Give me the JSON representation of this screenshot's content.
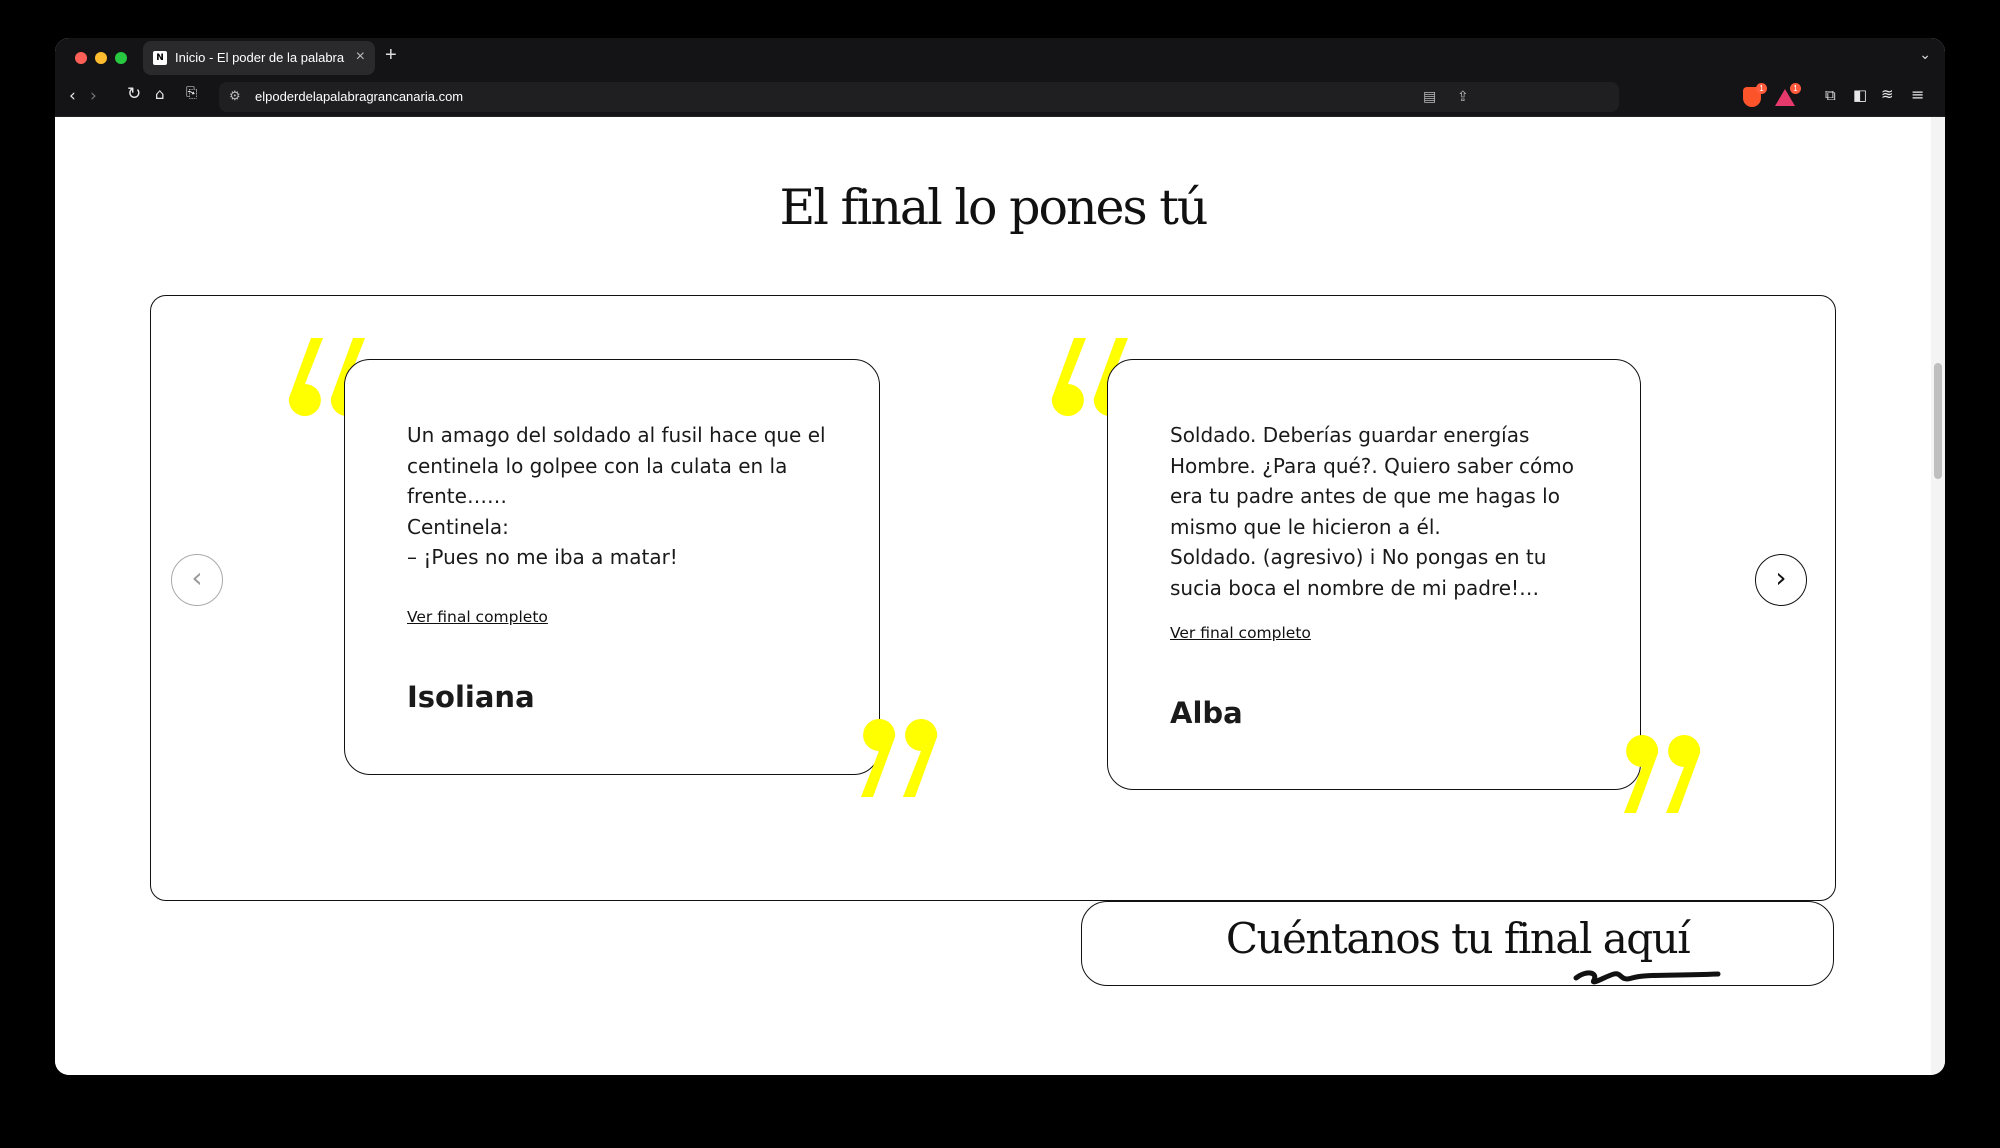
{
  "browser": {
    "tab_title": "Inicio - El poder de la palabra",
    "tab_favicon_text": "N",
    "url": "elpoderdelapalabragrancanaria.com",
    "brave_badge": "1",
    "rewards_badge": "1"
  },
  "section": {
    "title": "El final lo pones tú"
  },
  "carousel": {
    "cards": [
      {
        "excerpt": "Un amago del soldado al fusil hace que el centinela lo golpee con la culata en la frente……\nCentinela:\n– ¡Pues no me iba a matar!",
        "link_label": "Ver final completo",
        "author": "Isoliana"
      },
      {
        "excerpt": "Soldado. Deberías guardar energías\nHombre. ¿Para qué?. Quiero saber cómo era tu padre antes de que me hagas lo mismo que le hicieron a él.\nSoldado. (agresivo) i No pongas en tu sucia boca el nombre de mi padre!…",
        "link_label": "Ver final completo",
        "author": "Alba"
      }
    ]
  },
  "cta": {
    "label": "Cuéntanos tu final aquí"
  },
  "colors": {
    "accent_yellow": "#ffff00",
    "text": "#111111"
  }
}
